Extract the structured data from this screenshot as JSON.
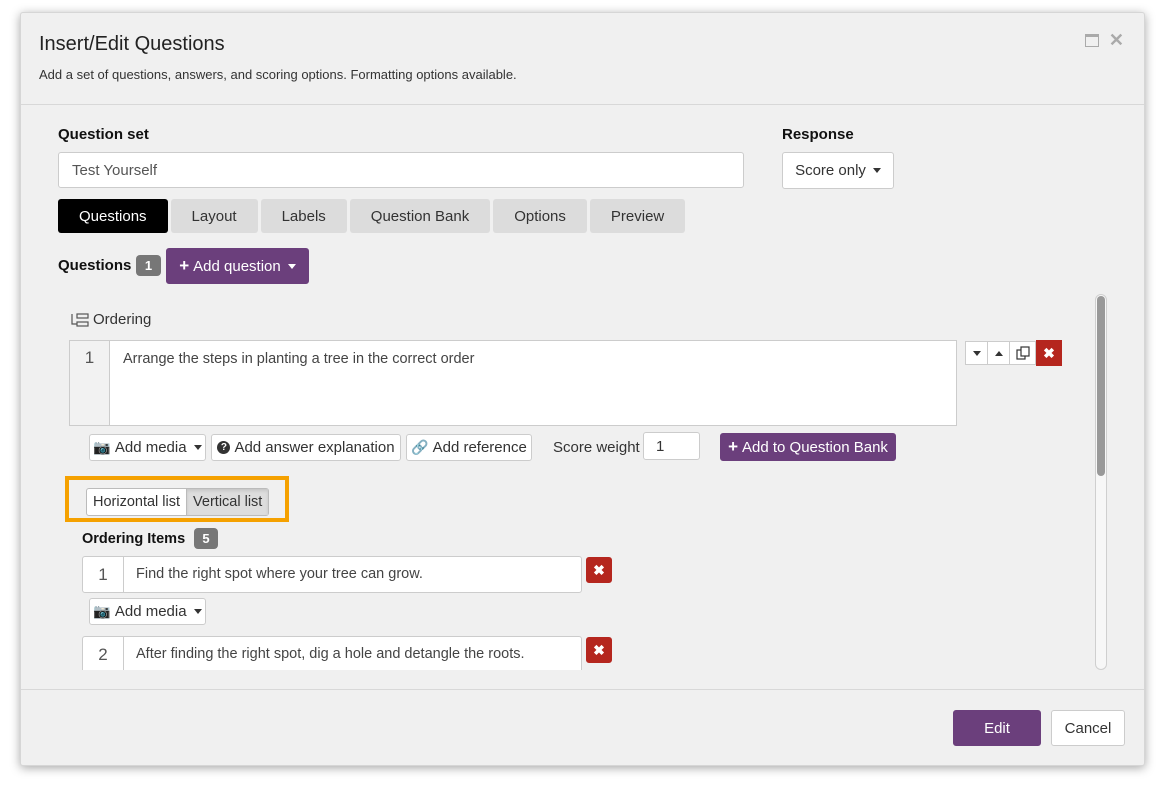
{
  "dialog": {
    "title": "Insert/Edit Questions",
    "subtitle": "Add a set of questions, answers, and scoring options. Formatting options available.",
    "icons": [
      "maximize-icon",
      "close-icon"
    ]
  },
  "question_set": {
    "label": "Question set",
    "value": "Test Yourself"
  },
  "response": {
    "label": "Response",
    "selected": "Score only"
  },
  "tabs": [
    {
      "label": "Questions",
      "active": true
    },
    {
      "label": "Layout"
    },
    {
      "label": "Labels"
    },
    {
      "label": "Question Bank"
    },
    {
      "label": "Options"
    },
    {
      "label": "Preview"
    }
  ],
  "questions": {
    "label": "Questions",
    "count": "1",
    "add_label": "Add question"
  },
  "question": {
    "type_label": "Ordering",
    "number": "1",
    "text": "Arrange the steps in planting a tree in the correct order",
    "add_media": "Add media",
    "add_explanation": "Add answer explanation",
    "add_reference": "Add reference",
    "score_weight_label": "Score weight",
    "score_weight": "1",
    "add_to_bank": "Add to Question Bank",
    "layout_options": [
      "Horizontal list",
      "Vertical list"
    ],
    "layout_selected": "Vertical list",
    "items_label": "Ordering Items",
    "items_count": "5",
    "items": [
      {
        "number": "1",
        "text": "Find the right spot where your tree can grow.",
        "add_media": "Add media"
      },
      {
        "number": "2",
        "text": "After finding the right spot, dig a hole and detangle the roots."
      }
    ]
  },
  "colors": {
    "accent": "#6b3f7c",
    "danger": "#b5261e",
    "highlight": "#f5a100",
    "active_tab": "#000000"
  },
  "footer": {
    "primary": "Edit",
    "secondary": "Cancel"
  }
}
